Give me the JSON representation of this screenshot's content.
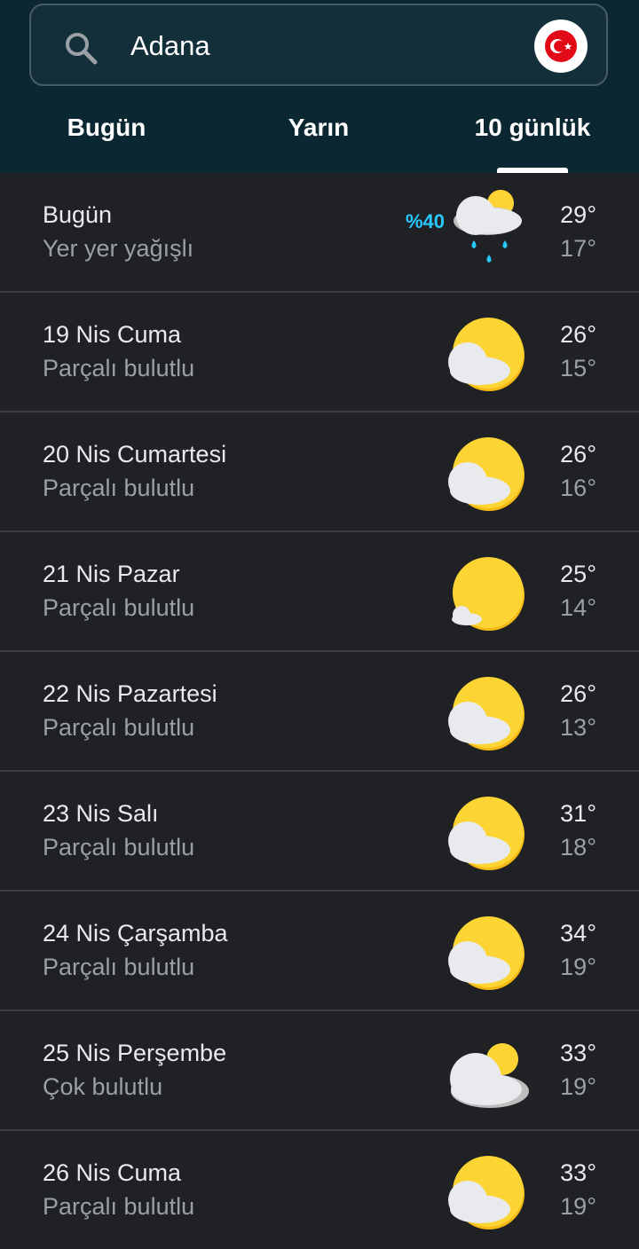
{
  "search": {
    "value": "Adana",
    "placeholder": "",
    "icon": "search-icon"
  },
  "country_flag": {
    "icon": "turkey-flag-icon",
    "color": "#e30a17"
  },
  "tabs": [
    {
      "label": "Bugün",
      "active": false
    },
    {
      "label": "Yarın",
      "active": false
    },
    {
      "label": "10 günlük",
      "active": true
    }
  ],
  "colors": {
    "header_bg": "#0b2731",
    "list_bg": "#202124",
    "precip": "#29c8ff",
    "sun": "#fcd535"
  },
  "forecast": [
    {
      "day": "Bugün",
      "condition": "Yer yer yağışlı",
      "precip": "%40",
      "icon": "rain-cloud-sun-icon",
      "high": "29°",
      "low": "17°"
    },
    {
      "day": "19 Nis Cuma",
      "condition": "Parçalı bulutlu",
      "precip": "",
      "icon": "partly-cloudy-icon",
      "high": "26°",
      "low": "15°"
    },
    {
      "day": "20 Nis Cumartesi",
      "condition": "Parçalı bulutlu",
      "precip": "",
      "icon": "partly-cloudy-icon",
      "high": "26°",
      "low": "16°"
    },
    {
      "day": "21 Nis Pazar",
      "condition": "Parçalı bulutlu",
      "precip": "",
      "icon": "mostly-sunny-icon",
      "high": "25°",
      "low": "14°"
    },
    {
      "day": "22 Nis Pazartesi",
      "condition": "Parçalı bulutlu",
      "precip": "",
      "icon": "partly-cloudy-icon",
      "high": "26°",
      "low": "13°"
    },
    {
      "day": "23 Nis Salı",
      "condition": "Parçalı bulutlu",
      "precip": "",
      "icon": "partly-cloudy-icon",
      "high": "31°",
      "low": "18°"
    },
    {
      "day": "24 Nis Çarşamba",
      "condition": "Parçalı bulutlu",
      "precip": "",
      "icon": "partly-cloudy-icon",
      "high": "34°",
      "low": "19°"
    },
    {
      "day": "25 Nis Perşembe",
      "condition": "Çok bulutlu",
      "precip": "",
      "icon": "mostly-cloudy-icon",
      "high": "33°",
      "low": "19°"
    },
    {
      "day": "26 Nis Cuma",
      "condition": "Parçalı bulutlu",
      "precip": "",
      "icon": "partly-cloudy-icon",
      "high": "33°",
      "low": "19°"
    }
  ]
}
